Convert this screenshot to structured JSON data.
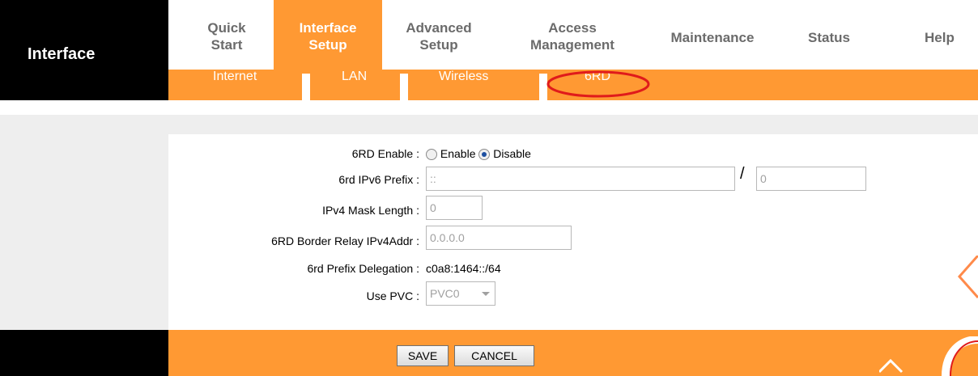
{
  "sidebar": {
    "title": "Interface"
  },
  "mainmenu": {
    "items": [
      {
        "line1": "Quick",
        "line2": "Start"
      },
      {
        "line1": "Interface",
        "line2": "Setup"
      },
      {
        "line1": "Advanced",
        "line2": "Setup"
      },
      {
        "line1": "Access",
        "line2": "Management"
      },
      {
        "line1": "Maintenance",
        "line2": ""
      },
      {
        "line1": "Status",
        "line2": ""
      },
      {
        "line1": "Help",
        "line2": ""
      }
    ],
    "active_index": 1
  },
  "submenu": {
    "items": [
      "Internet",
      "LAN",
      "Wireless",
      "6RD"
    ],
    "active": "6RD",
    "highlight_color": "#e01b1b"
  },
  "form": {
    "enable_label": "6RD Enable :",
    "enable_option": "Enable",
    "disable_option": "Disable",
    "selected": "Disable",
    "prefix_label": "6rd IPv6 Prefix :",
    "prefix_value": "::",
    "prefix_length_value": "0",
    "slash": "/",
    "mask_label": "IPv4 Mask Length :",
    "mask_value": "0",
    "relay_label": "6RD Border Relay IPv4Addr :",
    "relay_value": "0.0.0.0",
    "delegation_label": "6rd Prefix Delegation :",
    "delegation_value": "c0a8:1464::/64",
    "pvc_label": "Use PVC :",
    "pvc_value": "PVC0"
  },
  "buttons": {
    "save": "SAVE",
    "cancel": "CANCEL"
  },
  "colors": {
    "accent": "#ff9933",
    "sidebar": "#000000",
    "panel": "#eeeeee"
  }
}
